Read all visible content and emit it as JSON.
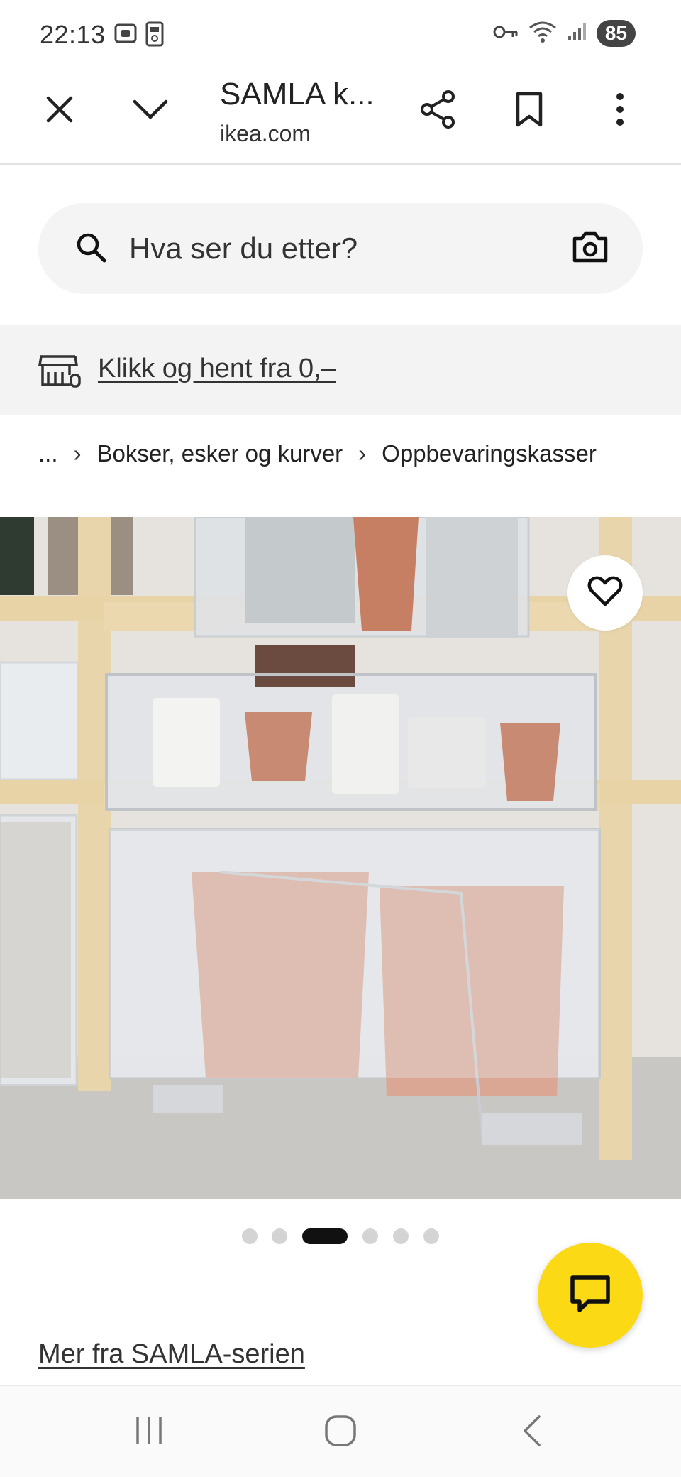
{
  "status_bar": {
    "time": "22:13",
    "battery": "85",
    "icons": [
      "screenshot-icon",
      "sim-icon",
      "key-icon",
      "wifi-icon",
      "signal-icon"
    ]
  },
  "browser": {
    "title": "SAMLA k...",
    "url": "ikea.com",
    "icons": [
      "close-icon",
      "chevron-down-icon",
      "share-icon",
      "bookmark-icon",
      "more-vert-icon"
    ]
  },
  "search": {
    "placeholder": "Hva ser du etter?",
    "icons": [
      "search-icon",
      "camera-icon"
    ]
  },
  "banner": {
    "text": "Klikk og hent fra 0,–",
    "icon": "store-icon"
  },
  "breadcrumb": {
    "ellipsis": "...",
    "separator": "›",
    "items": [
      "Bokser, esker og kurver",
      "Oppbevaringskasser"
    ]
  },
  "product_image": {
    "description_icon": "heart-icon",
    "carousel_total": 6,
    "carousel_active": 3
  },
  "links": {
    "series": "Mer fra SAMLA-serien"
  },
  "colors": {
    "ikea_yellow": "#fbd914",
    "banner_bg": "#f3f3f3",
    "search_bg": "#f4f4f4"
  },
  "nav": {
    "icons": [
      "recent-apps-icon",
      "home-icon",
      "back-icon"
    ]
  }
}
